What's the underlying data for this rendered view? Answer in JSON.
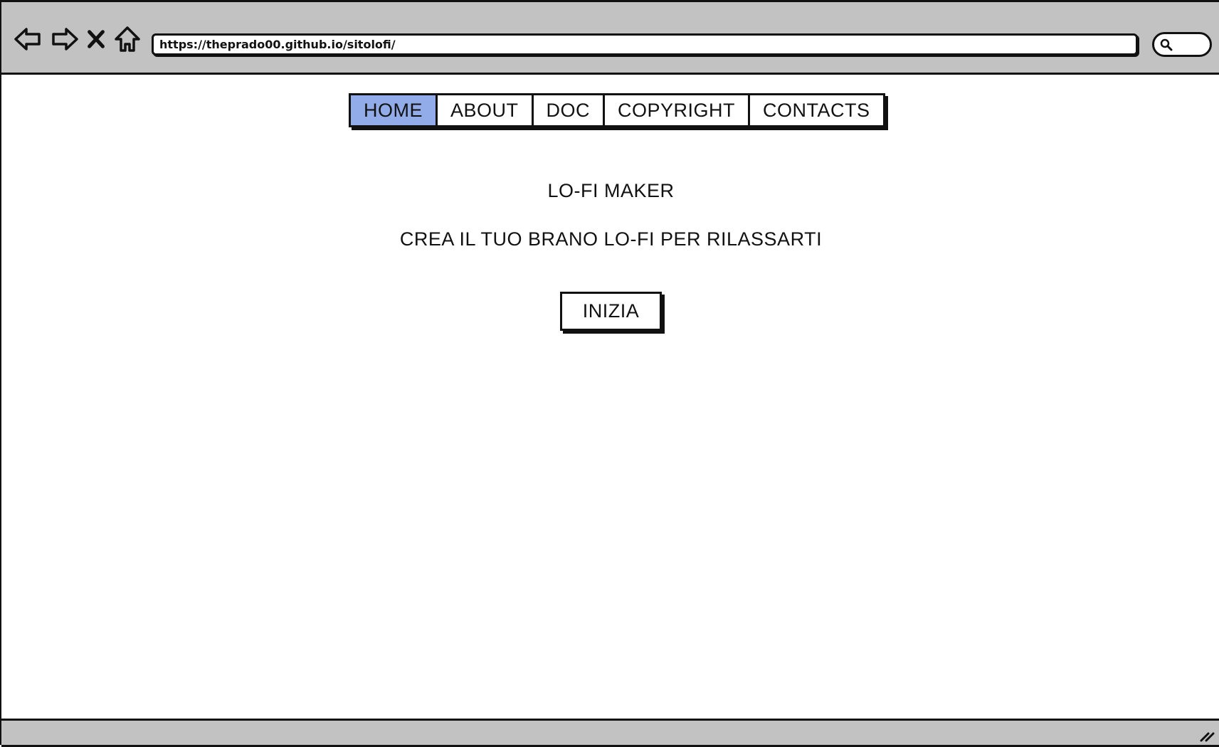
{
  "browser": {
    "url": "https://theprado00.github.io/sitolofi/",
    "icons": {
      "back": "back-arrow-icon",
      "forward": "forward-arrow-icon",
      "stop": "close-icon",
      "home": "home-icon",
      "search": "search-icon",
      "resize": "resize-grip-icon"
    }
  },
  "menu": {
    "items": [
      {
        "label": "HOME",
        "active": true
      },
      {
        "label": "ABOUT",
        "active": false
      },
      {
        "label": "DOC",
        "active": false
      },
      {
        "label": "COPYRIGHT",
        "active": false
      },
      {
        "label": "CONTACTS",
        "active": false
      }
    ]
  },
  "main": {
    "title": "LO-FI MAKER",
    "subtitle": "CREA IL TUO BRANO LO-FI PER RILASSARTI",
    "cta_label": "INIZIA"
  },
  "colors": {
    "chrome": "#c2c2c2",
    "active_tab": "#92acea",
    "stroke": "#111111"
  }
}
